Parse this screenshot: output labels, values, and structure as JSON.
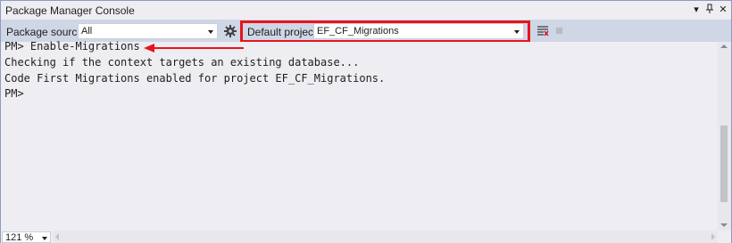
{
  "window": {
    "title": "Package Manager Console",
    "buttons": {
      "dropdown": "▾",
      "pin": "⊩",
      "close": "✕"
    }
  },
  "toolbar": {
    "package_source_label": "Package source:",
    "package_source_value": "All",
    "default_project_label": "Default project:",
    "default_project_value": "EF_CF_Migrations",
    "settings_icon": "gear-icon",
    "clear_icon": "clear-console-icon",
    "stop_icon": "stop-icon"
  },
  "console": {
    "lines": [
      "PM> Enable-Migrations",
      "Checking if the context targets an existing database...",
      "Code First Migrations enabled for project EF_CF_Migrations.",
      "PM>"
    ]
  },
  "bottom": {
    "zoom": "121 %"
  },
  "colors": {
    "highlight": "#e8141c",
    "toolbar_bg": "#cfd6e5",
    "console_bg": "#eeeef2",
    "text": "#1e1e1e"
  }
}
